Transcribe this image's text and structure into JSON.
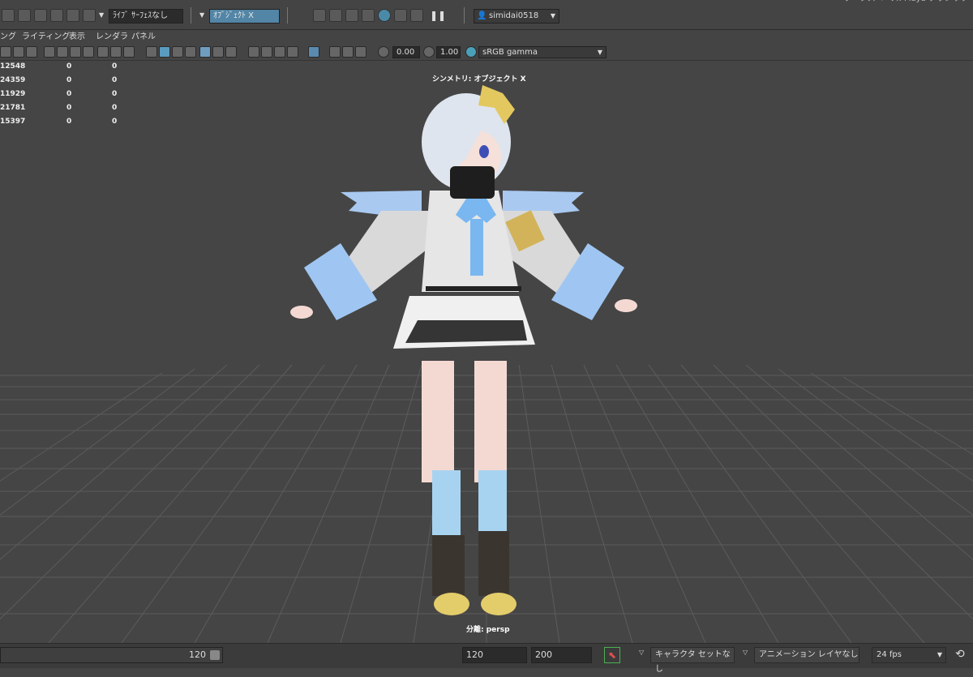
{
  "toolbar": {
    "live_surface": "ﾗｲﾌﾞ ｻｰﾌｪｽなし",
    "symmetry": "ｵﾌﾞｼﾞｪｸﾄ X",
    "user": "simidai0518",
    "workspace_partial": "ワークスペース: Maya クラシック"
  },
  "menu": {
    "items": [
      "ング",
      "ライティング",
      "表示",
      "レンダラ",
      "パネル"
    ]
  },
  "panel_toolbar": {
    "exposure": "0.00",
    "gamma": "1.00",
    "color_space": "sRGB gamma"
  },
  "hud": {
    "rows": [
      {
        "a": "12548",
        "b": "0",
        "c": "0"
      },
      {
        "a": "24359",
        "b": "0",
        "c": "0"
      },
      {
        "a": "11929",
        "b": "0",
        "c": "0"
      },
      {
        "a": "21781",
        "b": "0",
        "c": "0"
      },
      {
        "a": "15397",
        "b": "0",
        "c": "0"
      }
    ],
    "symmetry_label": "シンメトリ: オブジェクト X",
    "camera_label": "分離: persp"
  },
  "timeline": {
    "range_end": "120",
    "anim_end": "120",
    "total_end": "200",
    "character_set": "キャラクタ セットなし",
    "anim_layer": "アニメーション レイヤなし",
    "fps": "24 fps"
  },
  "colors": {
    "bg": "#444444",
    "field_selected": "#5285a6",
    "viewport": "#454545"
  }
}
